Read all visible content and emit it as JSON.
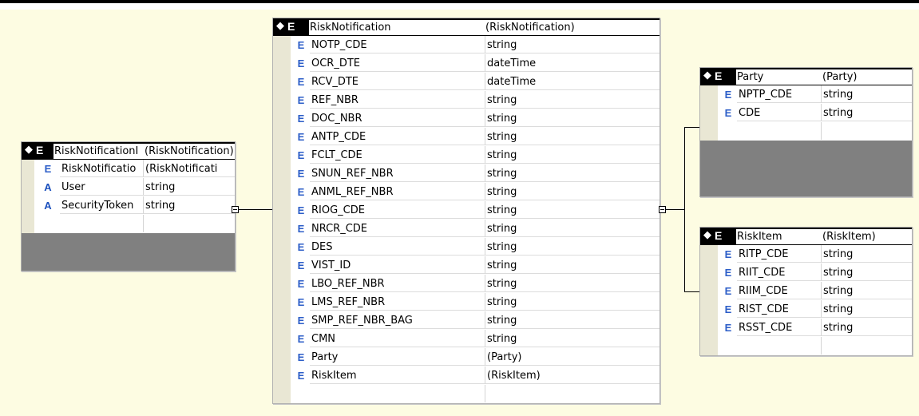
{
  "tables": {
    "request": {
      "name": "RiskNotificationI",
      "type": "(RiskNotification)",
      "rows": [
        {
          "kind": "E",
          "name": "RiskNotificatio",
          "type": "(RiskNotificati"
        },
        {
          "kind": "A",
          "name": "User",
          "type": "string"
        },
        {
          "kind": "A",
          "name": "SecurityToken",
          "type": "string"
        }
      ]
    },
    "risk_notification": {
      "name": "RiskNotification",
      "type": "(RiskNotification)",
      "rows": [
        {
          "kind": "E",
          "name": "NOTP_CDE",
          "type": "string"
        },
        {
          "kind": "E",
          "name": "OCR_DTE",
          "type": "dateTime"
        },
        {
          "kind": "E",
          "name": "RCV_DTE",
          "type": "dateTime"
        },
        {
          "kind": "E",
          "name": "REF_NBR",
          "type": "string"
        },
        {
          "kind": "E",
          "name": "DOC_NBR",
          "type": "string"
        },
        {
          "kind": "E",
          "name": "ANTP_CDE",
          "type": "string"
        },
        {
          "kind": "E",
          "name": "FCLT_CDE",
          "type": "string"
        },
        {
          "kind": "E",
          "name": "SNUN_REF_NBR",
          "type": "string"
        },
        {
          "kind": "E",
          "name": "ANML_REF_NBR",
          "type": "string"
        },
        {
          "kind": "E",
          "name": "RIOG_CDE",
          "type": "string"
        },
        {
          "kind": "E",
          "name": "NRCR_CDE",
          "type": "string"
        },
        {
          "kind": "E",
          "name": "DES",
          "type": "string"
        },
        {
          "kind": "E",
          "name": "VIST_ID",
          "type": "string"
        },
        {
          "kind": "E",
          "name": "LBO_REF_NBR",
          "type": "string"
        },
        {
          "kind": "E",
          "name": "LMS_REF_NBR",
          "type": "string"
        },
        {
          "kind": "E",
          "name": "SMP_REF_NBR_BAG",
          "type": "string"
        },
        {
          "kind": "E",
          "name": "CMN",
          "type": "string"
        },
        {
          "kind": "E",
          "name": "Party",
          "type": "(Party)"
        },
        {
          "kind": "E",
          "name": "RiskItem",
          "type": "(RiskItem)"
        }
      ]
    },
    "party": {
      "name": "Party",
      "type": "(Party)",
      "rows": [
        {
          "kind": "E",
          "name": "NPTP_CDE",
          "type": "string"
        },
        {
          "kind": "E",
          "name": "CDE",
          "type": "string"
        }
      ]
    },
    "risk_item": {
      "name": "RiskItem",
      "type": "(RiskItem)",
      "rows": [
        {
          "kind": "E",
          "name": "RITP_CDE",
          "type": "string"
        },
        {
          "kind": "E",
          "name": "RIIT_CDE",
          "type": "string"
        },
        {
          "kind": "E",
          "name": "RIIM_CDE",
          "type": "string"
        },
        {
          "kind": "E",
          "name": "RIST_CDE",
          "type": "string"
        },
        {
          "kind": "E",
          "name": "RSST_CDE",
          "type": "string"
        }
      ]
    }
  },
  "header_icon": "diamond-icon",
  "header_tag": "E",
  "colors": {
    "canvas": "#fdfce2",
    "element_kind": "#2c5ec8",
    "grey_area": "#808080",
    "gutter": "#e9e7d4"
  }
}
